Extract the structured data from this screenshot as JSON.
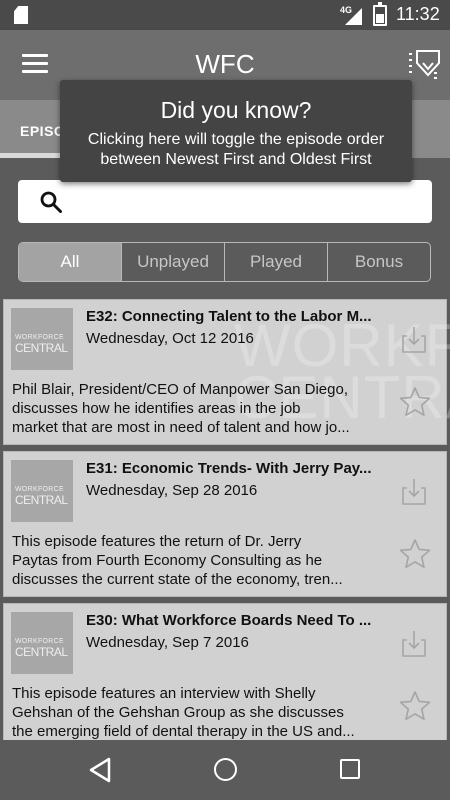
{
  "status_bar": {
    "time": "11:32",
    "network": "4G",
    "icons": [
      "sd-card-icon",
      "signal-icon",
      "battery-icon"
    ]
  },
  "app_bar": {
    "title": "WFC",
    "menu_icon": "menu-icon",
    "action_icon": "sort-order-icon"
  },
  "tabs": [
    {
      "label": "EPISO"
    }
  ],
  "tooltip": {
    "title": "Did you know?",
    "body_line1": "Clicking here will toggle the episode order",
    "body_line2": "between Newest First and Oldest First"
  },
  "search": {
    "placeholder": "",
    "value": ""
  },
  "filters": [
    {
      "label": "All",
      "active": true
    },
    {
      "label": "Unplayed",
      "active": false
    },
    {
      "label": "Played",
      "active": false
    },
    {
      "label": "Bonus",
      "active": false
    }
  ],
  "thumbnail": {
    "text_top": "WORKFORCE",
    "text_bottom": "CENTRAL"
  },
  "watermark": {
    "line1": "WORKFORCE",
    "line2": "CENTRAL"
  },
  "episodes": [
    {
      "title": "E32: Connecting Talent to the Labor M...",
      "date": "Wednesday, Oct 12 2016",
      "desc_lines": [
        "Phil Blair, President/CEO of Manpower San Diego,",
        "discusses how he identifies areas in the job",
        "market that are most in need of talent and how jo..."
      ]
    },
    {
      "title": "E31: Economic Trends- With Jerry Pay...",
      "date": "Wednesday, Sep 28 2016",
      "desc_lines": [
        "This episode features the return of Dr. Jerry",
        "Paytas from Fourth Economy Consulting as he",
        "discusses the current state of the economy, tren..."
      ]
    },
    {
      "title": "E30: What Workforce Boards Need To ...",
      "date": "Wednesday, Sep 7 2016",
      "desc_lines": [
        "This episode features an interview with Shelly",
        "Gehshan of the Gehshan Group as she discusses",
        "the emerging field of dental therapy in the US and..."
      ]
    }
  ],
  "nav_bar": {
    "icons": [
      "back-icon",
      "home-icon",
      "recent-apps-icon"
    ]
  },
  "colors": {
    "app_bar": "#6e6e6e",
    "tab_bar": "#8a8a8a",
    "status_bar": "#4a4a4a",
    "background": "#5b5b5b",
    "card": "#d1d1d1",
    "tooltip": "#444444"
  }
}
